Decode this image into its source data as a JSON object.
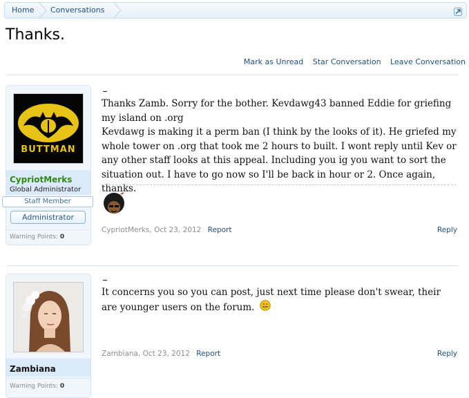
{
  "breadcrumb": {
    "home": "Home",
    "conversations": "Conversations"
  },
  "page_title": "Thanks.",
  "conversation_actions": {
    "mark_unread": "Mark as Unread",
    "star": "Star Conversation",
    "leave": "Leave Conversation"
  },
  "messages": [
    {
      "user": {
        "name": "CypriotMerks",
        "name_color": "#2e8b12",
        "title": "Global Administrator",
        "staff_label": "Staff Member",
        "banner": "Administrator",
        "avatar_text": "BUTTMAN",
        "warning_label": "Warning Points:",
        "warning_points": "0"
      },
      "text": "Thanks Zamb. Sorry for the bother. Kevdawg43 banned Eddie for griefing my island on .org\nKevdawg is making it a perm ban (I think by the looks of it). He griefed my whole tower on .org that took me 2 hours to built. I wont reply until Kev or any other staff looks at this appeal. Including you ig you want to sort the situation out. I have to go now so I'll be back in hour or 2. Once again, thanks.",
      "author": "CypriotMerks",
      "date": "Oct 23, 2012",
      "report": "Report",
      "reply": "Reply"
    },
    {
      "user": {
        "name": "Zambiana",
        "name_color": "#141414",
        "warning_label": "Warning Points:",
        "warning_points": "0"
      },
      "text": "It concerns you so you can post, just next time please don't swear, their are younger users on the forum.",
      "author": "Zambiana",
      "date": "Oct 23, 2012",
      "report": "Report",
      "reply": "Reply"
    }
  ],
  "colors": {
    "link": "#1f4f7e",
    "accent_border": "#c9dff2",
    "user_bg": "#f0f6fc"
  }
}
